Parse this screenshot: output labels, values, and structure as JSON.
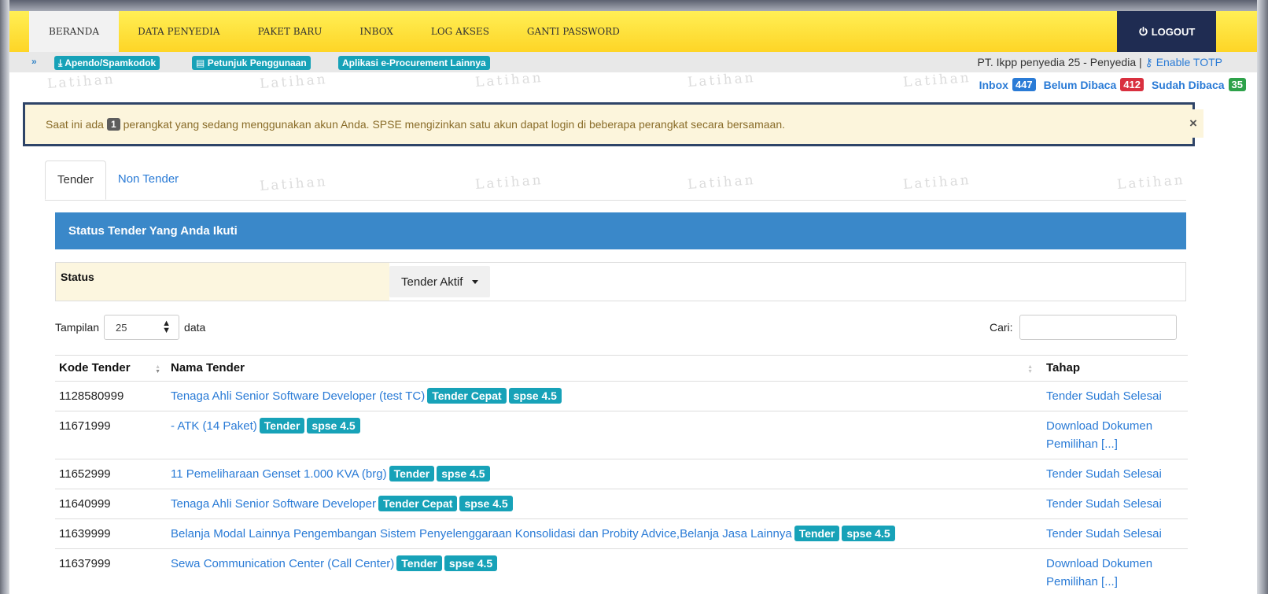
{
  "nav": {
    "items": [
      "BERANDA",
      "DATA PENYEDIA",
      "PAKET BARU",
      "INBOX",
      "LOG AKSES",
      "GANTI PASSWORD"
    ],
    "active_index": 0,
    "logout_label": "LOGOUT"
  },
  "subbar": {
    "links": [
      "Apendo/Spamkodok",
      "Petunjuk Penggunaan",
      "Aplikasi e-Procurement Lainnya"
    ],
    "user_text": "PT. Ikpp penyedia 25 - Penyedia |",
    "totp_label": "Enable TOTP"
  },
  "messages": {
    "inbox_label": "Inbox",
    "inbox_count": "447",
    "unread_label": "Belum Dibaca",
    "unread_count": "412",
    "read_label": "Sudah Dibaca",
    "read_count": "35"
  },
  "alert": {
    "before": "Saat ini ada",
    "count": "1",
    "after": "perangkat yang sedang menggunakan akun Anda. SPSE mengizinkan satu akun dapat login di beberapa perangkat secara bersamaan.",
    "close": "×"
  },
  "watermark": "Latihan",
  "tabs": [
    "Tender",
    "Non Tender"
  ],
  "panel_title": "Status Tender Yang Anda Ikuti",
  "filter": {
    "label": "Status",
    "value": "Tender Aktif"
  },
  "length": {
    "prefix": "Tampilan",
    "value": "25",
    "suffix": "data"
  },
  "search_label": "Cari:",
  "table": {
    "headers": [
      "Kode Tender",
      "Nama Tender",
      "Tahap"
    ],
    "rows": [
      {
        "kode": "1128580999",
        "nama": "Tenaga Ahli Senior Software Developer (test TC)",
        "tags": [
          "Tender Cepat",
          "spse 4.5"
        ],
        "tahap": "Tender Sudah Selesai"
      },
      {
        "kode": "11671999",
        "nama": "- ATK (14 Paket)",
        "tags": [
          "Tender",
          "spse 4.5"
        ],
        "tahap": "Download Dokumen Pemilihan [...]"
      },
      {
        "kode": "11652999",
        "nama": "11 Pemeliharaan Genset 1.000 KVA (brg)",
        "tags": [
          "Tender",
          "spse 4.5"
        ],
        "tahap": "Tender Sudah Selesai"
      },
      {
        "kode": "11640999",
        "nama": "Tenaga Ahli Senior Software Developer",
        "tags": [
          "Tender Cepat",
          "spse 4.5"
        ],
        "tahap": "Tender Sudah Selesai"
      },
      {
        "kode": "11639999",
        "nama": "Belanja Modal Lainnya Pengembangan Sistem Penyelenggaraan Konsolidasi dan Probity Advice,Belanja Jasa Lainnya",
        "tags": [
          "Tender",
          "spse 4.5"
        ],
        "tahap": "Tender Sudah Selesai"
      },
      {
        "kode": "11637999",
        "nama": "Sewa Communication Center (Call Center)",
        "tags": [
          "Tender",
          "spse 4.5"
        ],
        "tahap": "Download Dokumen Pemilihan [...]"
      }
    ]
  },
  "colors": {
    "nav_yellow": "#fed526",
    "logout_bg": "#1f2c52",
    "panel_blue": "#3a88c9",
    "tag_teal": "#17a2b8",
    "link_blue": "#2a7bd6"
  }
}
